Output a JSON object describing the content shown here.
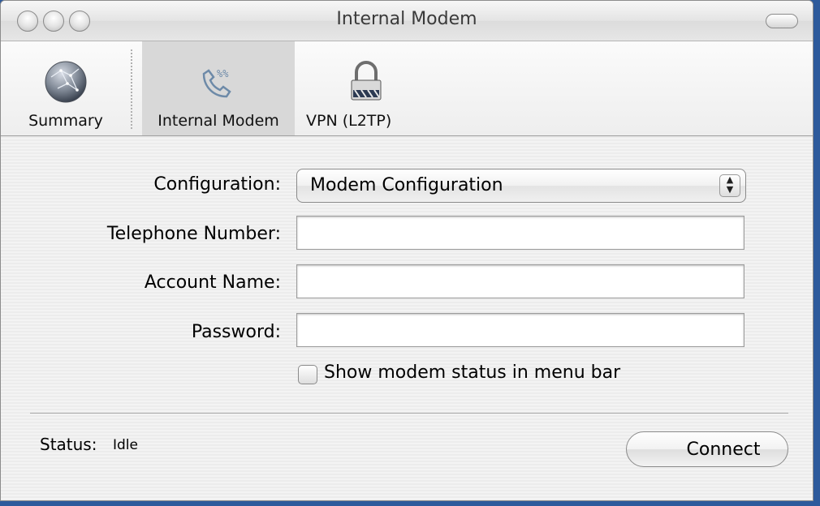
{
  "window": {
    "title": "Internal Modem"
  },
  "toolbar": {
    "items": [
      {
        "label": "Summary",
        "icon": "globe-icon"
      },
      {
        "label": "Internal Modem",
        "icon": "phone-icon",
        "selected": true
      },
      {
        "label": "VPN (L2TP)",
        "icon": "lock-icon"
      }
    ]
  },
  "form": {
    "configuration_label": "Configuration:",
    "configuration_value": "Modem Configuration",
    "telephone_label": "Telephone Number:",
    "telephone_value": "",
    "account_label": "Account Name:",
    "account_value": "",
    "password_label": "Password:",
    "password_value": "",
    "show_status_label": "Show modem status in menu bar",
    "show_status_checked": false
  },
  "status": {
    "label": "Status:",
    "value": "Idle"
  },
  "actions": {
    "connect_label": "Connect"
  }
}
